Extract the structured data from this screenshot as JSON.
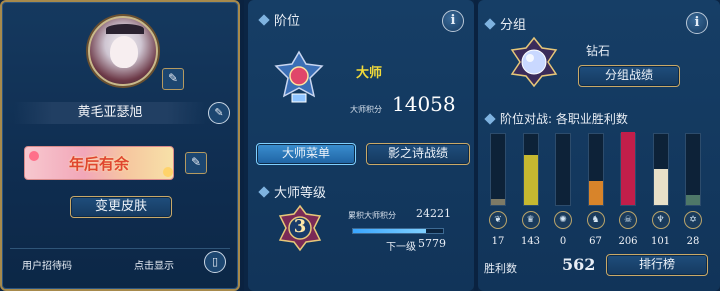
{
  "profile": {
    "name": "黄毛亚瑟旭",
    "title_banner": "年后有余",
    "change_skin_label": "变更皮肤",
    "invite_label": "用户招待码",
    "invite_value": "点击显示"
  },
  "rank": {
    "header": "阶位",
    "rank_name": "大师",
    "points_label": "大师积分",
    "points_value": "14058",
    "master_menu_label": "大师菜单",
    "shadowverse_label": "影之诗战绩",
    "level_header": "大师等级",
    "level_number": "3",
    "total_points_label": "累积大师积分",
    "total_points_value": "24221",
    "next_level_label": "下一级",
    "next_level_value": "5779",
    "next_level_progress": 0.81
  },
  "group": {
    "header": "分组",
    "group_name": "钻石",
    "group_record_label": "分组战绩",
    "wins_header": "阶位对战: 各职业胜利数",
    "wins_label": "胜利数",
    "wins_total": "562",
    "ranking_label": "排行榜",
    "classes": [
      {
        "icon": "forestcraft-icon",
        "glyph": "❦",
        "wins": "17",
        "level": 0.08,
        "color": "#7d7a66"
      },
      {
        "icon": "swordcraft-icon",
        "glyph": "♛",
        "wins": "143",
        "level": 0.69,
        "color": "#c6b830"
      },
      {
        "icon": "runecraft-icon",
        "glyph": "✺",
        "wins": "0",
        "level": 0.0,
        "color": "#5a5a5a"
      },
      {
        "icon": "dragoncraft-icon",
        "glyph": "♞",
        "wins": "67",
        "level": 0.33,
        "color": "#d8842a"
      },
      {
        "icon": "shadowcraft-icon",
        "glyph": "☠",
        "wins": "206",
        "level": 1.0,
        "color": "#c21e4a"
      },
      {
        "icon": "bloodcraft-icon",
        "glyph": "♆",
        "wins": "101",
        "level": 0.49,
        "color": "#e8e0c8"
      },
      {
        "icon": "havencraft-icon",
        "glyph": "✡",
        "wins": "28",
        "level": 0.14,
        "color": "#4e7868"
      }
    ]
  }
}
